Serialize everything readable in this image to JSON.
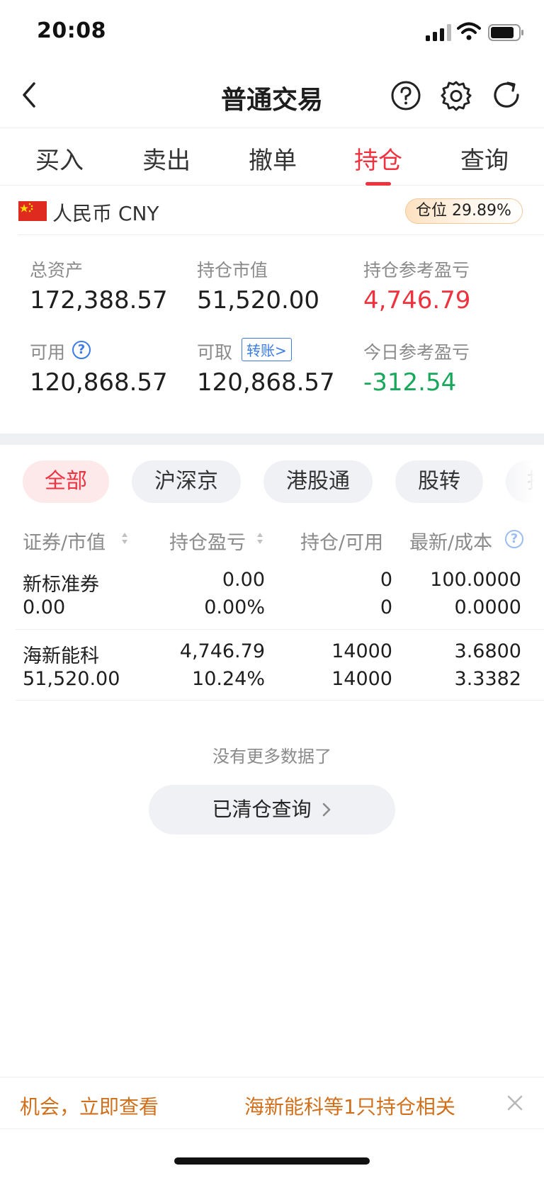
{
  "status_bar": {
    "time": "20:08"
  },
  "nav": {
    "title": "普通交易"
  },
  "tabs": [
    "买入",
    "卖出",
    "撤单",
    "持仓",
    "查询"
  ],
  "active_tab": "持仓",
  "account": {
    "currency": "人民币 CNY",
    "position_ratio": "仓位 29.89%",
    "total_assets_label": "总资产",
    "total_assets": "172,388.57",
    "market_value_label": "持仓市值",
    "market_value": "51,520.00",
    "pnl_label": "持仓参考盈亏",
    "pnl": "4,746.79",
    "available_label": "可用",
    "available": "120,868.57",
    "withdrawable_label": "可取",
    "transfer_label": "转账>",
    "withdrawable": "120,868.57",
    "today_pnl_label": "今日参考盈亏",
    "today_pnl": "-312.54"
  },
  "filters": [
    "全部",
    "沪深京",
    "港股通",
    "股转",
    "指"
  ],
  "table": {
    "headers": [
      "证券/市值",
      "持仓盈亏",
      "持仓/可用",
      "最新/成本"
    ],
    "rows": [
      {
        "name": "新标准券",
        "market_value": "0.00",
        "pnl": "0.00",
        "pnl_pct": "0.00%",
        "position": "0",
        "available": "0",
        "latest": "100.0000",
        "cost": "0.0000"
      },
      {
        "name": "海新能科",
        "market_value": "51,520.00",
        "pnl": "4,746.79",
        "pnl_pct": "10.24%",
        "position": "14000",
        "available": "14000",
        "latest": "3.6800",
        "cost": "3.3382"
      }
    ]
  },
  "no_more": "没有更多数据了",
  "cleared_query": "已清仓查询",
  "banner": {
    "left_text": "机会，立即查看",
    "right_text": "海新能科等1只持仓相关"
  },
  "colors": {
    "accent_red": "#f0313e",
    "up_green": "#19a85b",
    "link_blue": "#3a7be6",
    "banner_orange": "#d0701c"
  }
}
